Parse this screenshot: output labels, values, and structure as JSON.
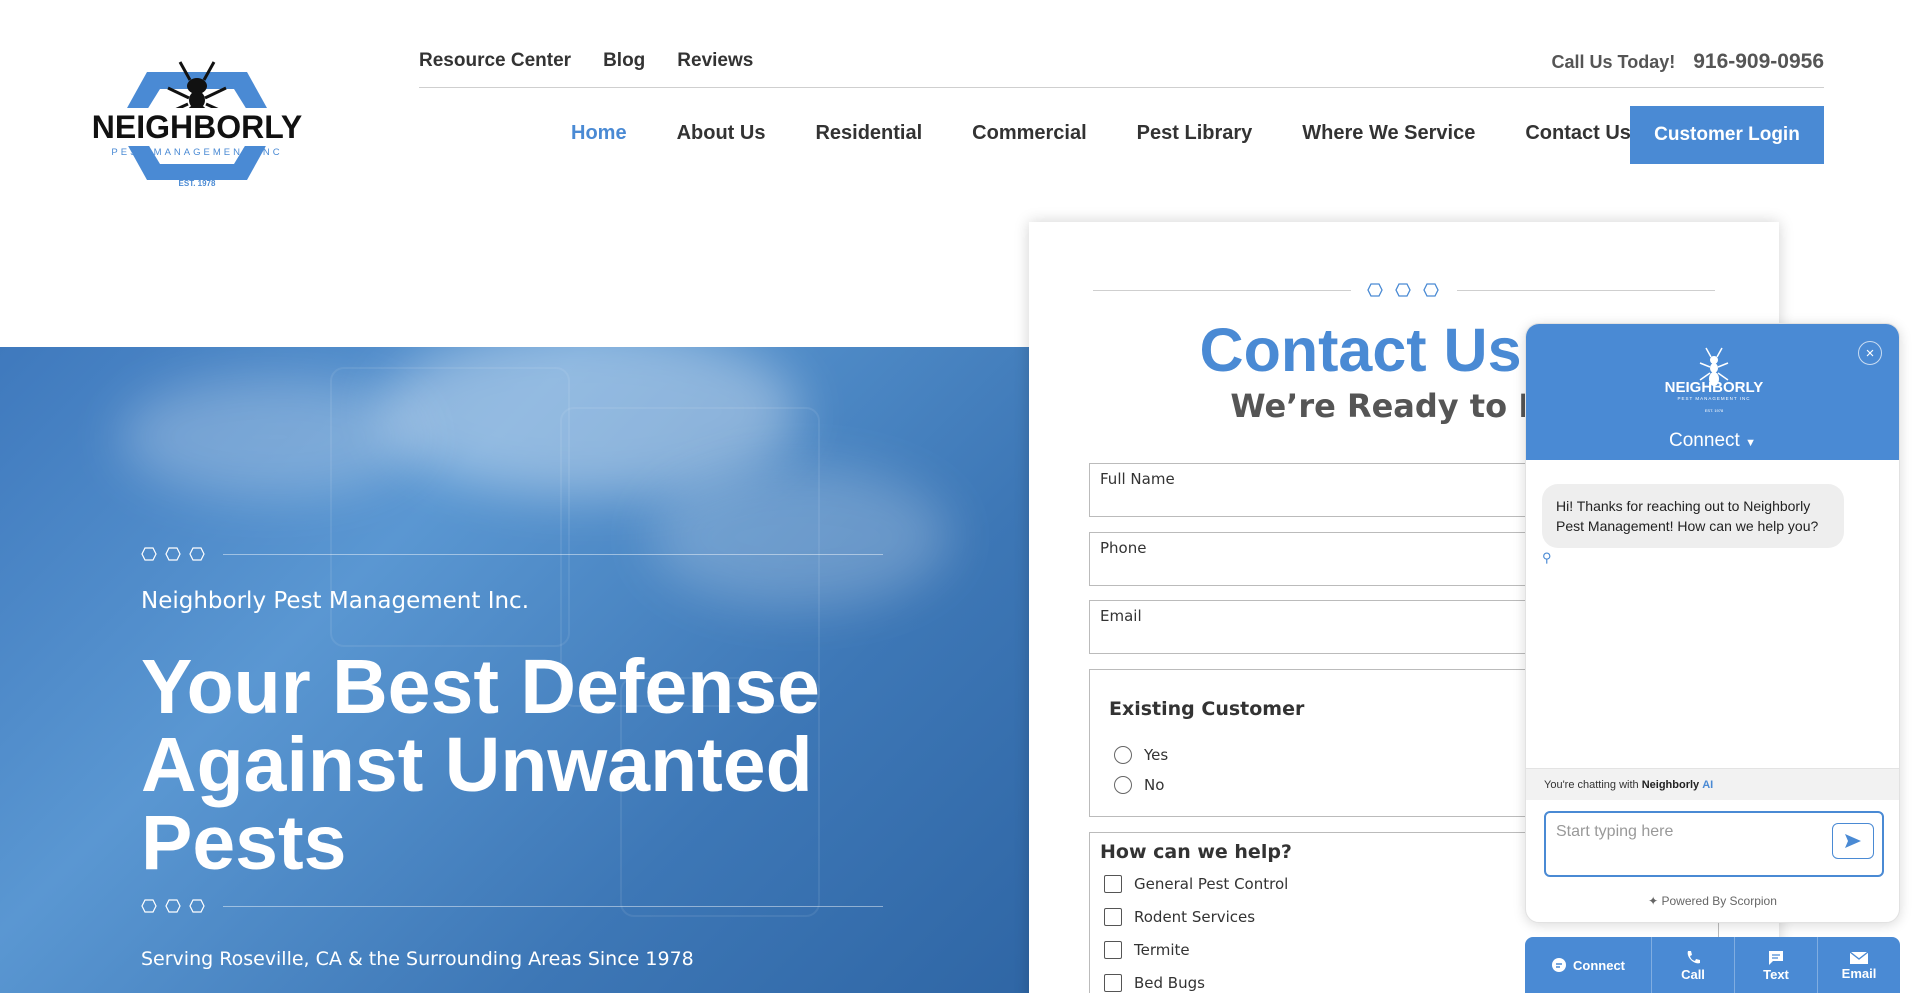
{
  "header": {
    "logo": {
      "wordmark": "NEIGHBORLY",
      "tagline": "PEST MANAGEMENT INC",
      "est": "EST. 1978"
    },
    "top_links": [
      "Resource Center",
      "Blog",
      "Reviews"
    ],
    "call_label": "Call Us Today!",
    "phone": "916-909-0956",
    "nav": [
      "Home",
      "About Us",
      "Residential",
      "Commercial",
      "Pest Library",
      "Where We Service",
      "Contact Us"
    ],
    "active_nav": "Home",
    "login_label": "Customer Login"
  },
  "hero": {
    "company": "Neighborly Pest Management Inc.",
    "title": "Your Best Defense Against Unwanted Pests",
    "serving": "Serving Roseville, CA & the Surrounding Areas Since 1978"
  },
  "form": {
    "title": "Contact Us To",
    "subtitle": "We’re Ready to Hel",
    "fields": [
      "Full Name",
      "Phone",
      "Email"
    ],
    "existing_customer": {
      "title": "Existing Customer",
      "options": [
        "Yes",
        "No"
      ]
    },
    "help": {
      "title": "How can we help?",
      "options": [
        "General Pest Control",
        "Rodent Services",
        "Termite",
        "Bed Bugs"
      ]
    }
  },
  "chat": {
    "connect_label": "Connect",
    "close_icon": "×",
    "message": "Hi! Thanks for reaching out to Neighborly Pest Management! How can we help you?",
    "status_prefix": "You're chatting with",
    "status_name": "Neighborly",
    "status_ai": "AI",
    "input_placeholder": "Start typing here",
    "powered": "Powered By Scorpion"
  },
  "bottombar": [
    "Connect",
    "Call",
    "Text",
    "Email"
  ],
  "colors": {
    "brand": "#4a8ad4",
    "text": "#333333"
  }
}
